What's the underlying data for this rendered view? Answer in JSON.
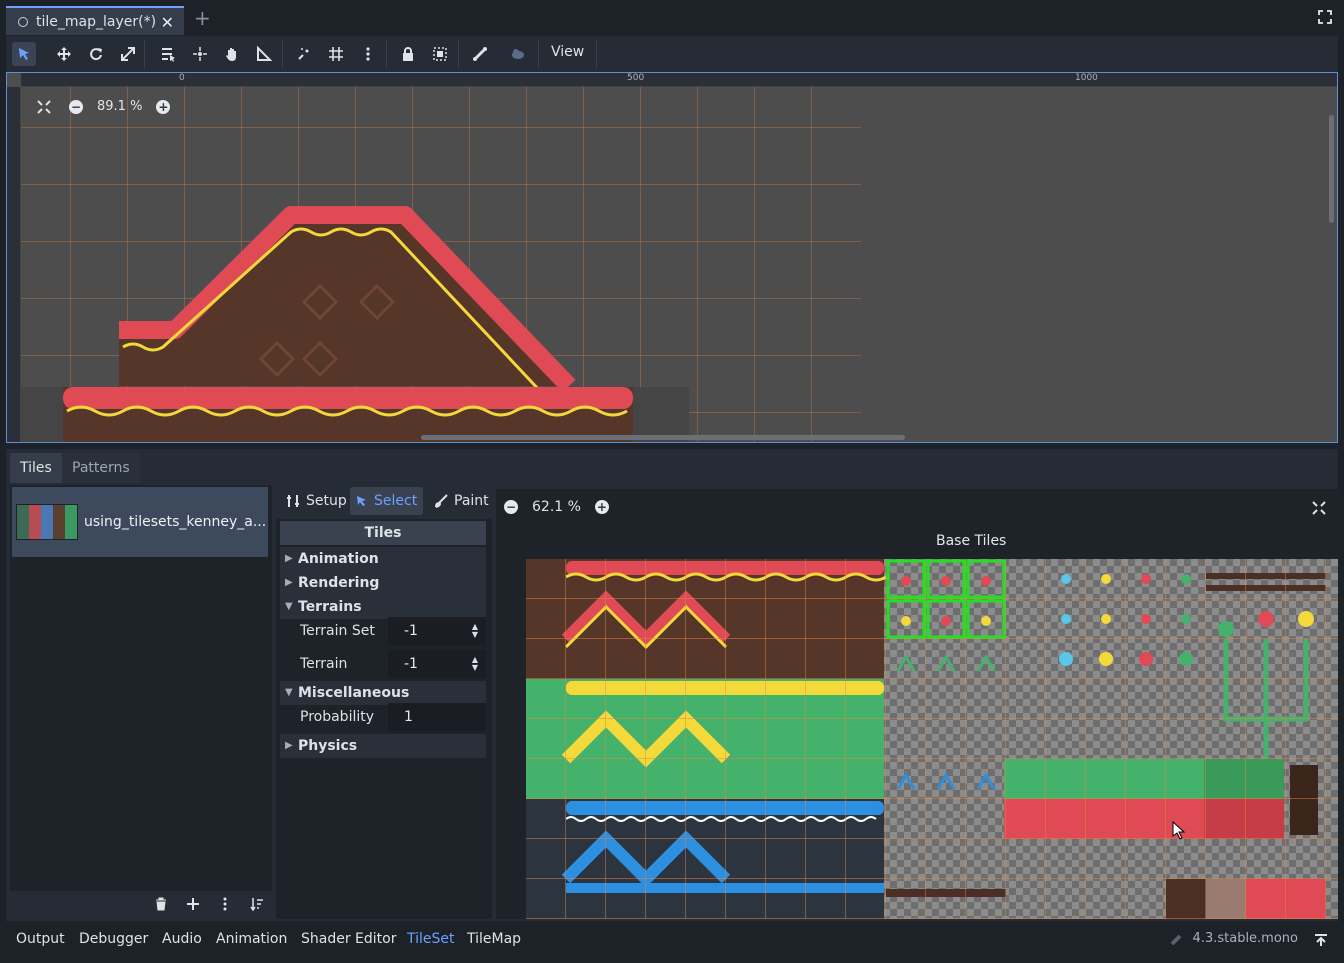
{
  "tabs": {
    "active_tab": "tile_map_layer(*)",
    "close": "✕",
    "add": "+"
  },
  "toolbar": {
    "view_label": "View"
  },
  "viewport": {
    "ruler": [
      "0",
      "500",
      "1000"
    ],
    "zoom": "89.1 %"
  },
  "bottom": {
    "tabs": {
      "tiles": "Tiles",
      "patterns": "Patterns"
    },
    "source": {
      "label": "using_tilesets_kenney_a..."
    },
    "inspector": {
      "tools": {
        "setup": "Setup",
        "select": "Select",
        "paint": "Paint"
      },
      "header": "Tiles",
      "sections": {
        "animation": "Animation",
        "rendering": "Rendering",
        "terrains": "Terrains",
        "misc": "Miscellaneous",
        "physics": "Physics"
      },
      "props": {
        "terrain_set": {
          "label": "Terrain Set",
          "value": "-1"
        },
        "terrain": {
          "label": "Terrain",
          "value": "-1"
        },
        "probability": {
          "label": "Probability",
          "value": "1"
        }
      }
    },
    "atlas": {
      "zoom": "62.1 %",
      "title": "Base Tiles"
    }
  },
  "status": {
    "items": [
      "Output",
      "Debugger",
      "Audio",
      "Animation",
      "Shader Editor",
      "TileSet",
      "TileMap"
    ],
    "active": "TileSet",
    "version": "4.3.stable.mono"
  },
  "colors": {
    "accent": "#6ba2ff",
    "grass": "#45b26b",
    "soil": "#57362a",
    "red": "#df4a55",
    "yellow": "#f4d93b",
    "water": "#2d8fe0",
    "grid": "#e1864a",
    "selected": "#22e022"
  }
}
